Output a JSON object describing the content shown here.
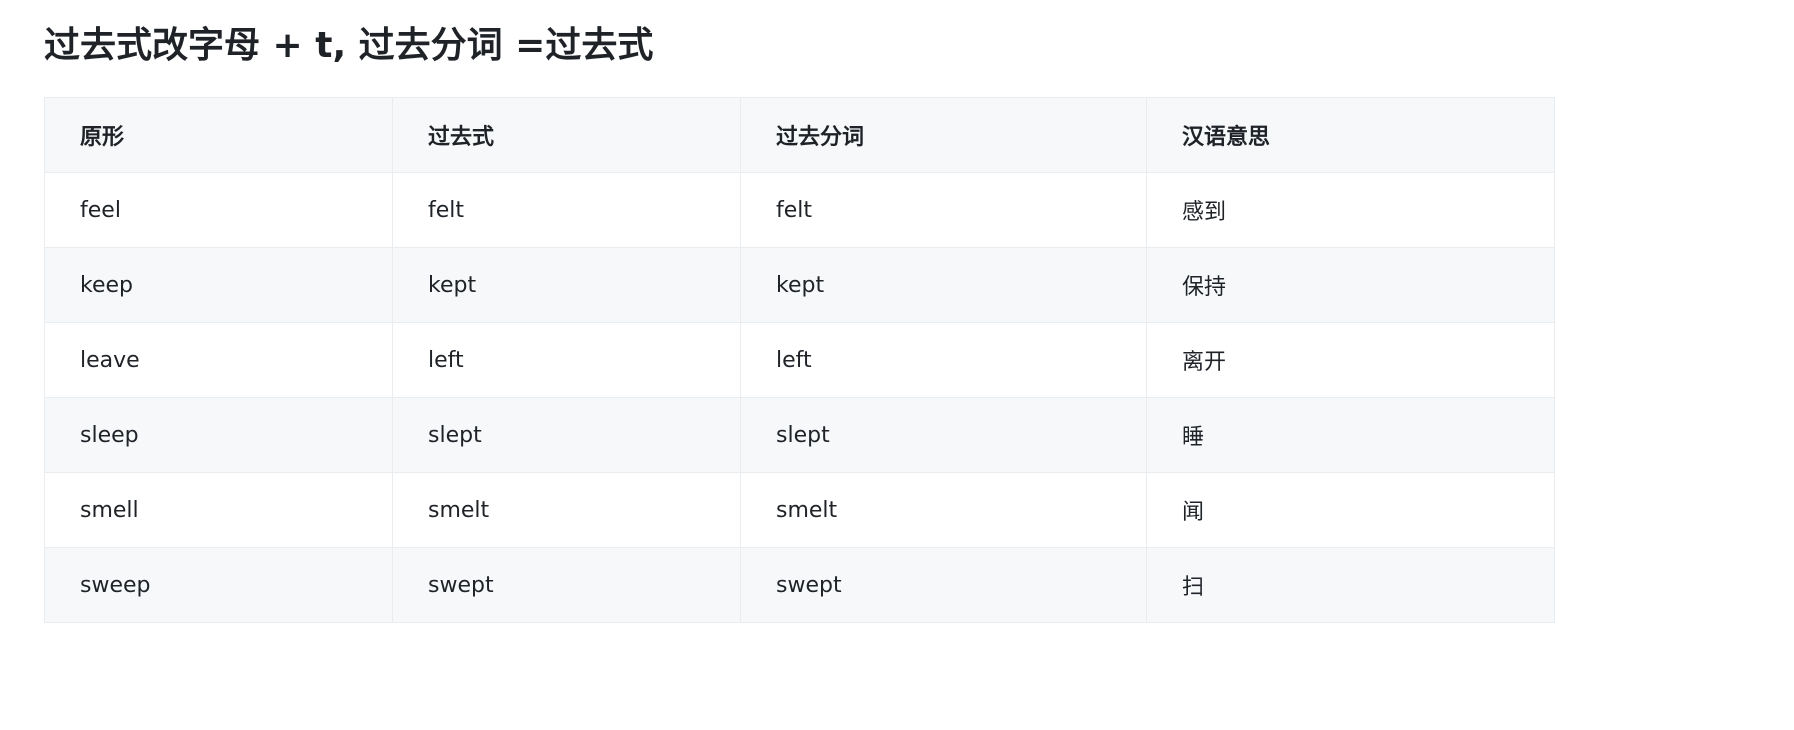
{
  "title": "过去式改字母 + t, 过去分词 =过去式",
  "table": {
    "headers": [
      "原形",
      "过去式",
      "过去分词",
      "汉语意思"
    ],
    "rows": [
      [
        "feel",
        "felt",
        "felt",
        "感到"
      ],
      [
        "keep",
        "kept",
        "kept",
        "保持"
      ],
      [
        "leave",
        "left",
        "left",
        "离开"
      ],
      [
        "sleep",
        "slept",
        "slept",
        "睡"
      ],
      [
        "smell",
        "smelt",
        "smelt",
        "闻"
      ],
      [
        "sweep",
        "swept",
        "swept",
        "扫"
      ]
    ]
  }
}
